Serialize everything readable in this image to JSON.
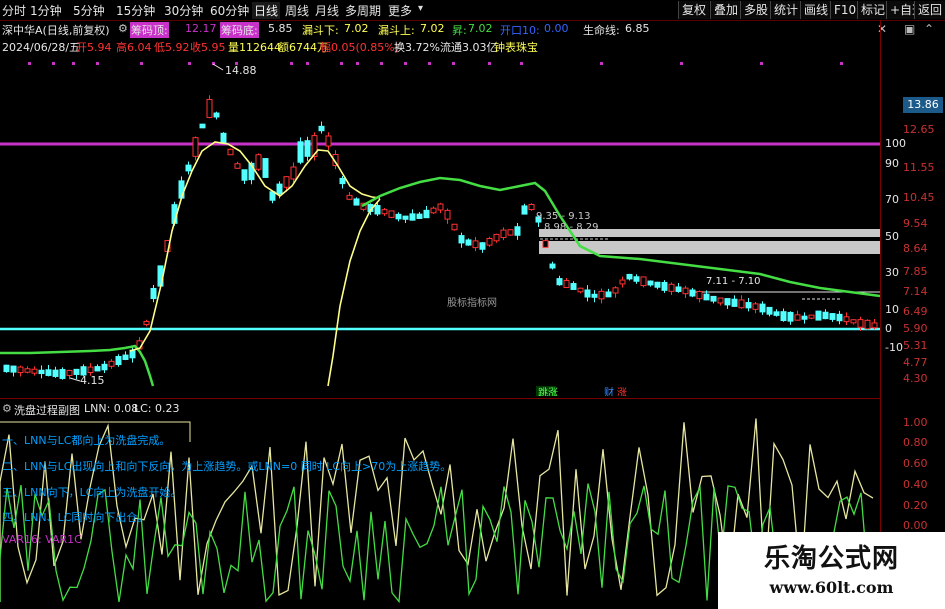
{
  "toolbar": {
    "periods": [
      "分时",
      "1分钟",
      "5分钟",
      "15分钟",
      "30分钟",
      "60分钟",
      "日线",
      "周线",
      "月线",
      "多周期",
      "更多"
    ],
    "active_period": "日线",
    "buttons": [
      "复权",
      "叠加",
      "多股",
      "统计",
      "画线",
      "F10",
      "标记",
      "+自选",
      "返回"
    ]
  },
  "info1": {
    "title": "深中华A(日线,前复权)",
    "chip_top_label": "筹码顶:",
    "chip_top_value": "12.17",
    "chip_bottom_label": "筹码底:",
    "chip_bottom_value": "5.85",
    "leak_down_label": "漏斗下:",
    "leak_down_value": "7.02",
    "leak_up_label": "漏斗上:",
    "leak_up_value": "7.02",
    "up_label": "昇:",
    "up_value": "7.02",
    "open_label": "开口10:",
    "open_value": "0.00",
    "life_label": "生命线:",
    "life_value": "6.85"
  },
  "info2": {
    "date": "2024/06/28/五",
    "open": "开5.94",
    "high": "高6.04",
    "low": "低5.92",
    "close": "收5.95",
    "volume": "量112644",
    "amount": "额6744万",
    "change": "幅0.05(0.85%)",
    "turnover": "换3.72%",
    "float": "流通3.03亿",
    "tag": "钟表珠宝"
  },
  "main": {
    "high_mark": "14.88",
    "low_mark": "4.15",
    "label_935": "9.35 - 9.13",
    "label_898": "8.98 - 8.29",
    "label_711": "7.11 - 7.10",
    "center_watermark": "股标指标网",
    "marker_jinpan": "跳涨",
    "marker_cai": "财",
    "marker_zhang": "涨"
  },
  "right_axis": {
    "current_price": "13.86",
    "price_ticks": [
      "12.65",
      "11.55",
      "10.45",
      "9.54",
      "8.64",
      "7.85",
      "7.14",
      "6.49",
      "5.90",
      "5.31",
      "4.77",
      "4.30"
    ],
    "osc_ticks": [
      "100",
      "90",
      "70",
      "50",
      "30",
      "10",
      "0",
      "-10"
    ],
    "sub_ticks": [
      "1.00",
      "0.80",
      "0.60",
      "0.40",
      "0.20",
      "0.00"
    ]
  },
  "sub": {
    "title": "洗盘过程副图",
    "lnn_label": "LNN: 0.08",
    "lc_label": "LC: 0.23",
    "explanations": [
      "一、LNN与LC都向上为洗盘完成。",
      "二、LNN与LC出现向上和向下反向，为上涨趋势。或LNN=0 同时 LC向上>70为上涨趋势。",
      "三、LNN向下，LC向上为洗盘开始。",
      "四、LNN、LC同时向下出仓。"
    ],
    "var_labels": "VAR16: VAR1C"
  },
  "watermark": {
    "title": "乐淘公式网",
    "url": "www.60lt.com"
  },
  "colors": {
    "up": "#ff3232",
    "down": "#54ffff",
    "magenta_line": "#c832c8",
    "cyan_line": "#54ffff",
    "yellow_curve": "#ffff88",
    "green_curve": "#44dd44",
    "gray_band": "#c8c8c8"
  }
}
